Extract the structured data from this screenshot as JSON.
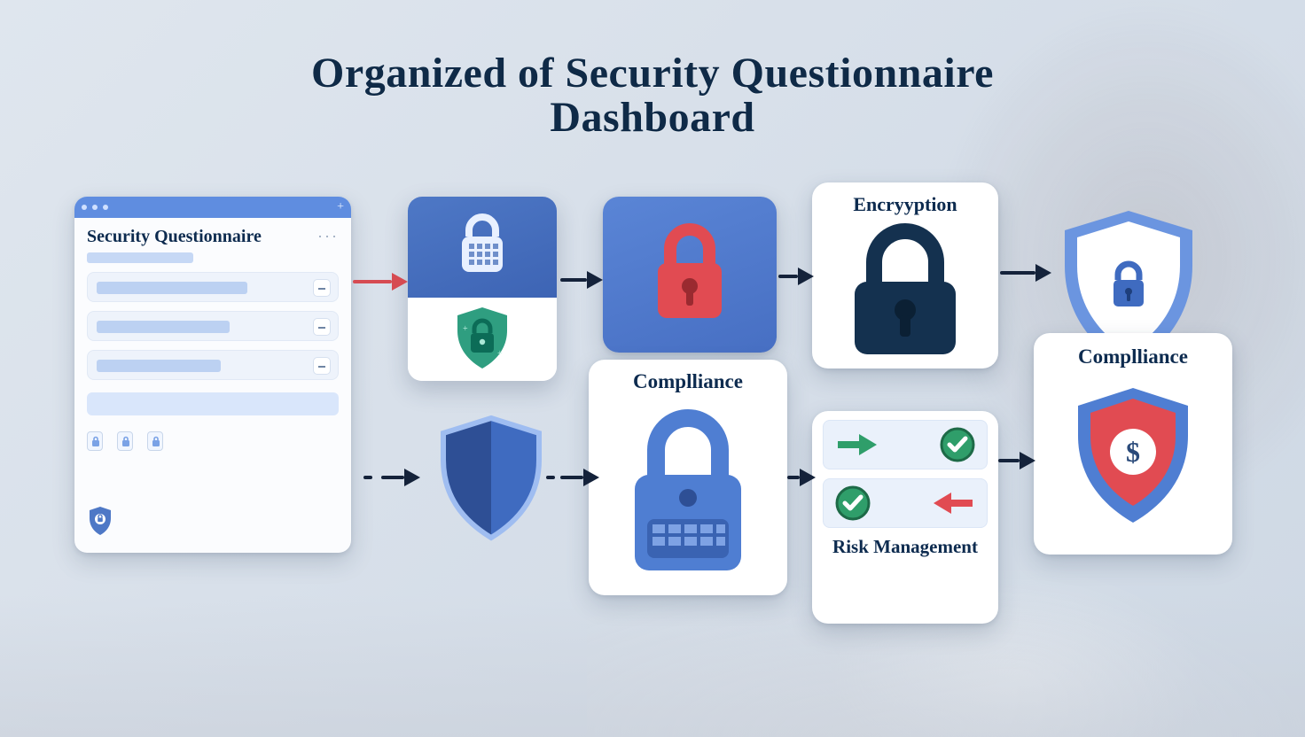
{
  "title_line1": "Organized of Security Questionnaire",
  "title_line2": "Dashboard",
  "panel": {
    "heading": "Security Questionnaire",
    "menu_glyph": "···"
  },
  "cards": {
    "encryption": "Encryyption",
    "compliance_center": "Complliance",
    "risk": "Risk Management",
    "compliance_right": "Complliance"
  },
  "icons": {
    "shield": "shield-icon",
    "lock": "lock-icon",
    "padlock_red": "padlock-red-icon",
    "padlock_dark": "padlock-dark-icon",
    "padlock_blue_keypad": "padlock-keypad-icon",
    "shield_dollar": "shield-dollar-icon",
    "check": "check-icon",
    "arrow_right_green": "arrow-right-green-icon",
    "arrow_left_red": "arrow-left-red-icon"
  },
  "colors": {
    "ink": "#0f2a47",
    "blue": "#4e78c6",
    "blue_dark": "#3d64b4",
    "red": "#e14b52",
    "navy": "#14314f",
    "green": "#2f9e6a"
  },
  "flow": [
    "Security Questionnaire",
    "security-card",
    "red-lock",
    "Encryyption",
    "shield-badge"
  ],
  "flow_lower": [
    "Security Questionnaire",
    "shield",
    "Complliance",
    "Risk Management",
    "Complliance"
  ]
}
